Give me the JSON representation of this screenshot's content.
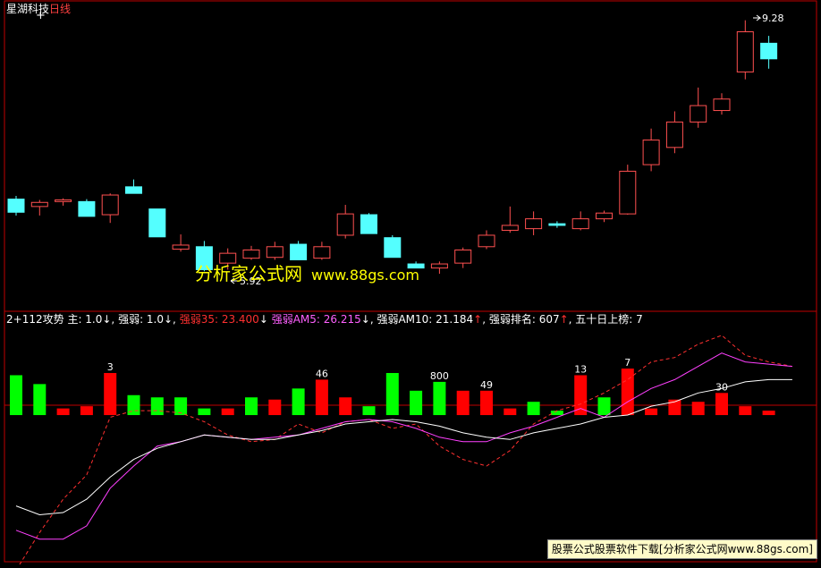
{
  "title": {
    "stock": "星湖科技",
    "period": "日线",
    "cross_mark": "+"
  },
  "price_labels": {
    "high": "9.28",
    "low": "5.92"
  },
  "indicator_bar": [
    {
      "text": "2+112攻势",
      "color": "#ffffff"
    },
    {
      "text": "主: 1.0↓, 强弱: 1.0↓,",
      "color": "#ffffff"
    },
    {
      "text": "强弱35: 23.400",
      "color": "#ff3030"
    },
    {
      "text": "↓",
      "color": "#ffffff"
    },
    {
      "text": "强弱AM5: 26.215",
      "color": "#ff60ff"
    },
    {
      "text": "↓, 强弱AM10: 21.184",
      "color": "#ffffff"
    },
    {
      "text": "↑",
      "color": "#ff3030"
    },
    {
      "text": ", 强弱排名: 607",
      "color": "#ffffff"
    },
    {
      "text": "↑",
      "color": "#ff3030"
    },
    {
      "text": ", 五十日上榜: 7",
      "color": "#ffffff"
    }
  ],
  "bar_labels": [
    "3",
    "46",
    "800",
    "49",
    "13",
    "7",
    "30"
  ],
  "watermark": {
    "name": "分析家公式网",
    "url": "www.88gs.com"
  },
  "footer": "股票公式股票软件下载[分析家公式网www.88gs.com]",
  "colors": {
    "up": "#ff5050",
    "down": "#54ffff",
    "bar_up": "#ff0000",
    "bar_down": "#00ff00",
    "frame": "#c00000",
    "line_white": "#ffffff",
    "line_magenta": "#ff40ff",
    "line_dash": "#ff3030"
  },
  "chart_data": [
    {
      "type": "candlestick",
      "title": "星湖科技 日线",
      "candles": [
        {
          "o": 7.06,
          "c": 6.9,
          "h": 7.1,
          "l": 6.86
        },
        {
          "o": 6.97,
          "c": 7.02,
          "h": 7.05,
          "l": 6.86
        },
        {
          "o": 7.03,
          "c": 7.05,
          "h": 7.07,
          "l": 6.98
        },
        {
          "o": 7.03,
          "c": 6.85,
          "h": 7.06,
          "l": 6.85
        },
        {
          "o": 6.87,
          "c": 7.11,
          "h": 7.13,
          "l": 6.77
        },
        {
          "o": 7.21,
          "c": 7.13,
          "h": 7.3,
          "l": 7.13
        },
        {
          "o": 6.94,
          "c": 6.6,
          "h": 6.94,
          "l": 6.6
        },
        {
          "o": 6.45,
          "c": 6.5,
          "h": 6.63,
          "l": 6.42
        },
        {
          "o": 6.48,
          "c": 6.2,
          "h": 6.55,
          "l": 6.18
        },
        {
          "o": 6.28,
          "c": 6.4,
          "h": 6.46,
          "l": 6.2
        },
        {
          "o": 6.34,
          "c": 6.44,
          "h": 6.49,
          "l": 6.32
        },
        {
          "o": 6.35,
          "c": 6.48,
          "h": 6.54,
          "l": 6.32
        },
        {
          "o": 6.51,
          "c": 6.32,
          "h": 6.55,
          "l": 6.32
        },
        {
          "o": 6.34,
          "c": 6.48,
          "h": 6.54,
          "l": 6.32
        },
        {
          "o": 6.62,
          "c": 6.88,
          "h": 6.99,
          "l": 6.58
        },
        {
          "o": 6.87,
          "c": 6.64,
          "h": 6.89,
          "l": 6.64
        },
        {
          "o": 6.59,
          "c": 6.35,
          "h": 6.62,
          "l": 6.35
        },
        {
          "o": 6.27,
          "c": 6.22,
          "h": 6.3,
          "l": 6.22
        },
        {
          "o": 6.22,
          "c": 6.27,
          "h": 6.3,
          "l": 6.15
        },
        {
          "o": 6.28,
          "c": 6.44,
          "h": 6.47,
          "l": 6.22
        },
        {
          "o": 6.48,
          "c": 6.62,
          "h": 6.68,
          "l": 6.45
        },
        {
          "o": 6.68,
          "c": 6.74,
          "h": 6.97,
          "l": 6.65
        },
        {
          "o": 6.7,
          "c": 6.82,
          "h": 6.91,
          "l": 6.62
        },
        {
          "o": 6.76,
          "c": 6.74,
          "h": 6.79,
          "l": 6.71
        },
        {
          "o": 6.7,
          "c": 6.82,
          "h": 6.91,
          "l": 6.68
        },
        {
          "o": 6.82,
          "c": 6.89,
          "h": 6.92,
          "l": 6.78
        },
        {
          "o": 6.88,
          "c": 7.4,
          "h": 7.48,
          "l": 6.87
        },
        {
          "o": 7.48,
          "c": 7.78,
          "h": 7.92,
          "l": 7.4
        },
        {
          "o": 7.69,
          "c": 8.0,
          "h": 8.13,
          "l": 7.62
        },
        {
          "o": 8.0,
          "c": 8.2,
          "h": 8.42,
          "l": 7.93
        },
        {
          "o": 8.14,
          "c": 8.28,
          "h": 8.35,
          "l": 8.09
        },
        {
          "o": 8.61,
          "c": 9.1,
          "h": 9.24,
          "l": 8.52
        },
        {
          "o": 8.96,
          "c": 8.77,
          "h": 9.05,
          "l": 8.65
        }
      ],
      "price_range": [
        5.78,
        9.4
      ],
      "annotations": [
        {
          "label": "9.28",
          "index": 31
        },
        {
          "label": "5.92",
          "index": 8
        }
      ]
    },
    {
      "type": "bar_line",
      "bars": [
        18,
        14,
        3,
        4,
        19,
        9,
        8,
        8,
        3,
        3,
        8,
        7,
        12,
        16,
        8,
        4,
        19,
        11,
        15,
        11,
        11,
        3,
        6,
        2,
        18,
        8,
        21,
        3,
        7,
        6,
        10,
        4,
        2
      ],
      "bar_up": [
        false,
        false,
        true,
        true,
        true,
        false,
        false,
        false,
        false,
        true,
        false,
        true,
        false,
        true,
        true,
        false,
        false,
        false,
        false,
        true,
        true,
        true,
        false,
        false,
        true,
        false,
        true,
        true,
        true,
        true,
        true,
        true,
        true
      ],
      "white_line": [
        -41,
        -45,
        -44,
        -38,
        -28,
        -20,
        -15,
        -12,
        -9,
        -10,
        -11,
        -11,
        -9,
        -7,
        -4,
        -3,
        -2,
        -3,
        -5,
        -8,
        -10,
        -11,
        -8,
        -6,
        -4,
        -1,
        0,
        4,
        6,
        10,
        12,
        15,
        16,
        16
      ],
      "magenta_line": [
        -52,
        -56,
        -56,
        -50,
        -33,
        -23,
        -14,
        -12,
        -9,
        -10,
        -11,
        -10,
        -9,
        -6,
        -3,
        -2,
        -3,
        -6,
        -10,
        -12,
        -12,
        -8,
        -5,
        -1,
        3,
        -1,
        6,
        12,
        16,
        22,
        28,
        24,
        23,
        22
      ],
      "dashed_line": [
        -70,
        -53,
        -38,
        -27,
        -1,
        2,
        2,
        1,
        -3,
        -9,
        -12,
        -11,
        -4,
        -8,
        -3,
        -2,
        -6,
        -4,
        -14,
        -20,
        -23,
        -16,
        -4,
        2,
        5,
        10,
        16,
        24,
        26,
        32,
        36,
        27,
        24,
        22
      ],
      "value_labels": [
        {
          "label": "3",
          "index": 4
        },
        {
          "label": "46",
          "index": 13
        },
        {
          "label": "800",
          "index": 18
        },
        {
          "label": "49",
          "index": 20
        },
        {
          "label": "13",
          "index": 24
        },
        {
          "label": "7",
          "index": 26
        },
        {
          "label": "30",
          "index": 30
        }
      ],
      "y_range": [
        -65,
        40
      ]
    }
  ]
}
